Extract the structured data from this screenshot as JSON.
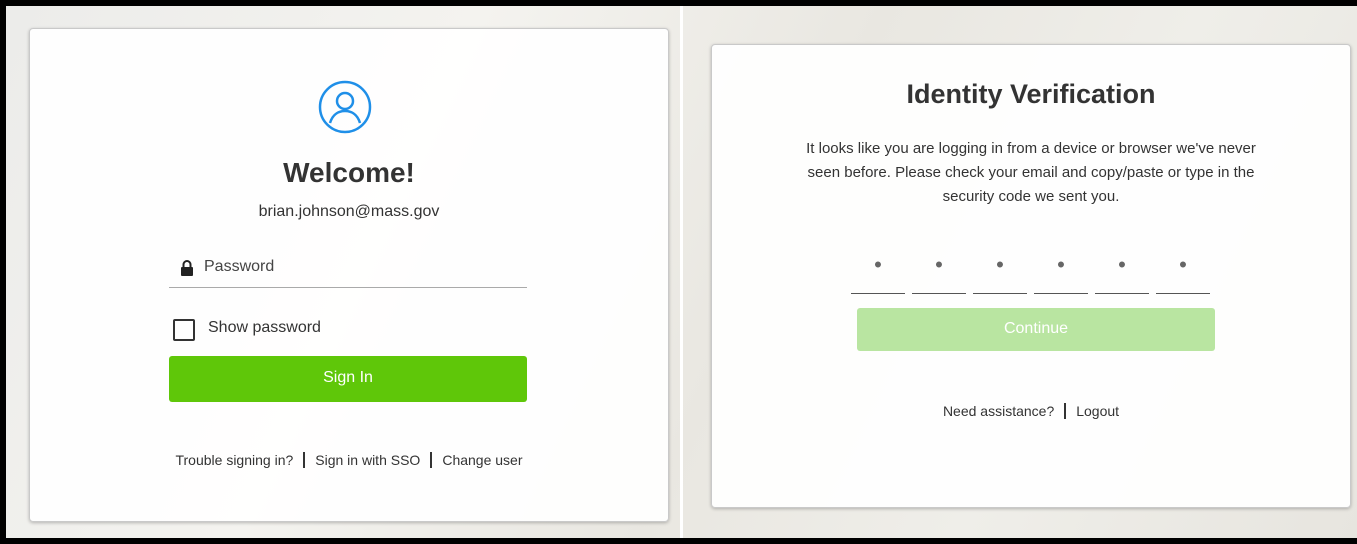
{
  "login": {
    "title": "Welcome!",
    "email": "brian.johnson@mass.gov",
    "password_placeholder": "Password",
    "show_password_label": "Show password",
    "sign_in_label": "Sign In",
    "links": {
      "trouble": "Trouble signing in?",
      "sso": "Sign in with SSO",
      "change_user": "Change user"
    }
  },
  "verification": {
    "title": "Identity Verification",
    "description": "It looks like you are logging in from a device or browser we've never seen before. Please check your email and copy/paste or type in the security code we sent you.",
    "code_slots": [
      "•",
      "•",
      "•",
      "•",
      "•",
      "•"
    ],
    "continue_label": "Continue",
    "links": {
      "assistance": "Need assistance?",
      "logout": "Logout"
    }
  },
  "icons": {
    "avatar": "user-avatar-icon",
    "lock": "lock-icon"
  },
  "colors": {
    "primary_green": "#5fc709",
    "disabled_green": "#b9e5a1",
    "icon_blue": "#1f8fe8",
    "text": "#333333"
  }
}
